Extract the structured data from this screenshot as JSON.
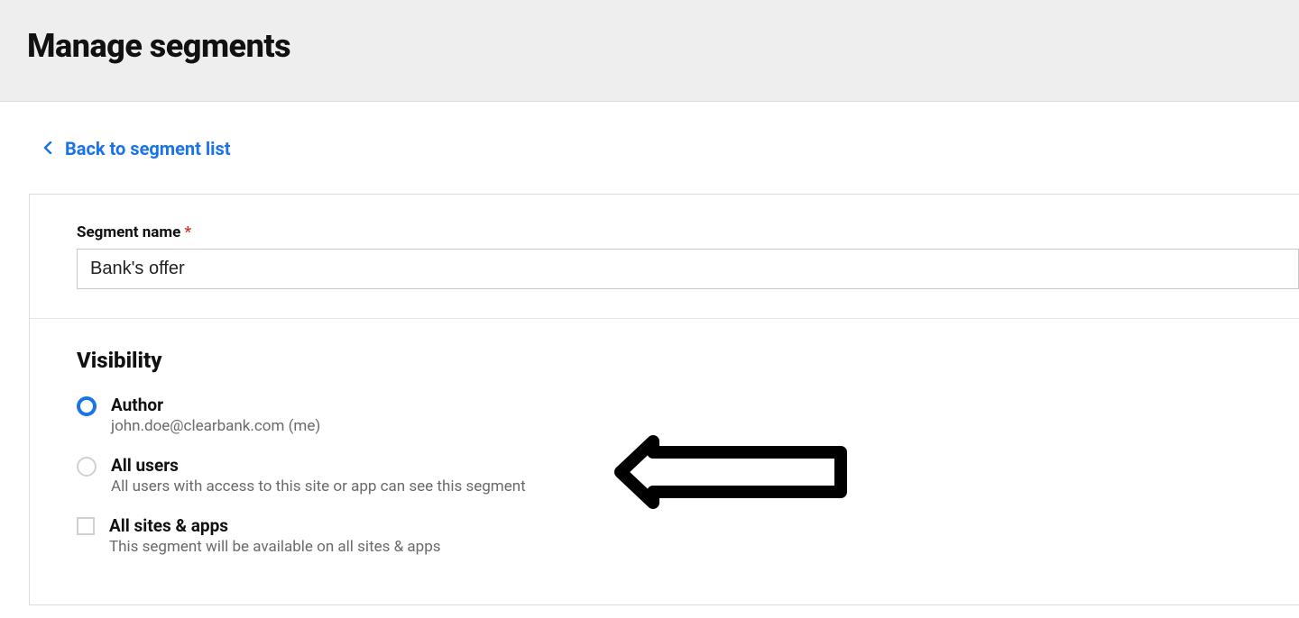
{
  "header": {
    "title": "Manage segments"
  },
  "back_link": {
    "label": "Back to segment list"
  },
  "form": {
    "segment_name": {
      "label": "Segment name",
      "value": "Bank's offer"
    },
    "visibility": {
      "heading": "Visibility",
      "options": {
        "author": {
          "label": "Author",
          "description": "john.doe@clearbank.com (me)"
        },
        "all_users": {
          "label": "All users",
          "description": "All users with access to this site or app can see this segment"
        },
        "all_sites": {
          "label": "All sites & apps",
          "description": "This segment will be available on all sites & apps"
        }
      }
    }
  }
}
